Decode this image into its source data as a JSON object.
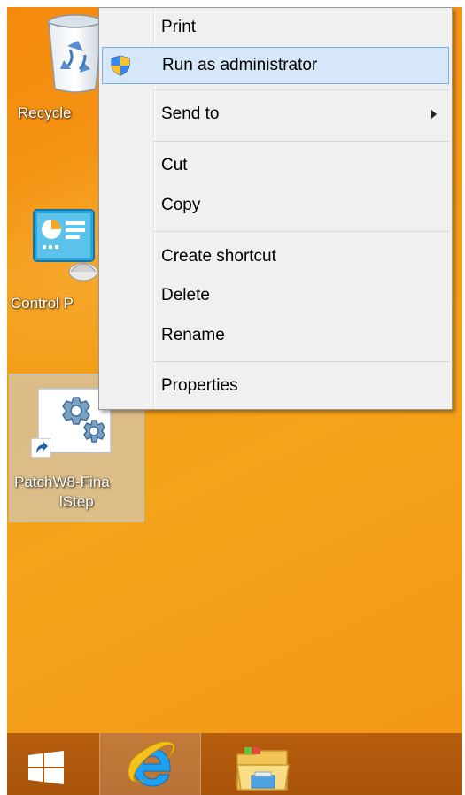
{
  "desktop": {
    "icons": [
      {
        "id": "recycle",
        "label": "Recycle"
      },
      {
        "id": "control",
        "label": "Control P"
      },
      {
        "id": "patch",
        "label_line1": "PatchW8-Fina",
        "label_line2": "lStep"
      }
    ]
  },
  "context_menu": {
    "items": [
      {
        "label": "Print"
      },
      {
        "label": "Run as administrator",
        "icon": "uac-shield-icon"
      },
      {
        "label": "Send to",
        "submenu": true
      },
      {
        "label": "Cut"
      },
      {
        "label": "Copy"
      },
      {
        "label": "Create shortcut"
      },
      {
        "label": "Delete"
      },
      {
        "label": "Rename"
      },
      {
        "label": "Properties"
      }
    ]
  },
  "taskbar": {
    "buttons": [
      {
        "id": "start",
        "icon": "windows-logo-icon"
      },
      {
        "id": "ie",
        "icon": "internet-explorer-icon"
      },
      {
        "id": "explorer",
        "icon": "file-explorer-icon"
      }
    ]
  },
  "colors": {
    "desktop_orange": "#f39a16",
    "taskbar_brown": "#b05a0d",
    "menu_bg": "#f0f0f0",
    "menu_highlight": "#d5e7f8",
    "menu_highlight_border": "#7ab1e8"
  }
}
